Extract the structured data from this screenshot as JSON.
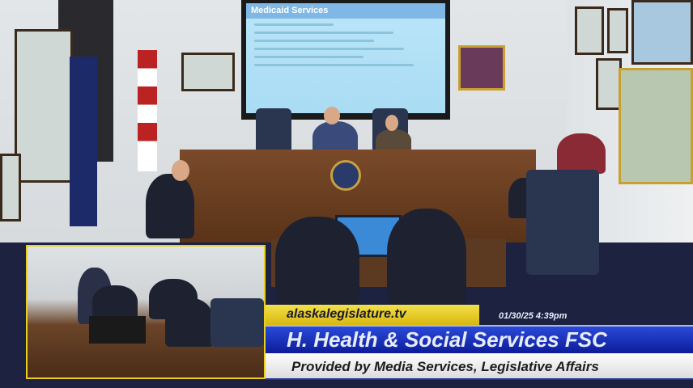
{
  "presentation": {
    "slide_title": "Medicaid Services"
  },
  "overlay": {
    "website": "alaskalegislature.tv",
    "timestamp": "01/30/25 4:39pm",
    "committee": "H. Health & Social Services FSC",
    "credit": "Provided by Media Services, Legislative Affairs"
  },
  "colors": {
    "banner_blue": "#1a34c0",
    "banner_yellow": "#e8cc20",
    "pip_border": "#e8d020"
  }
}
